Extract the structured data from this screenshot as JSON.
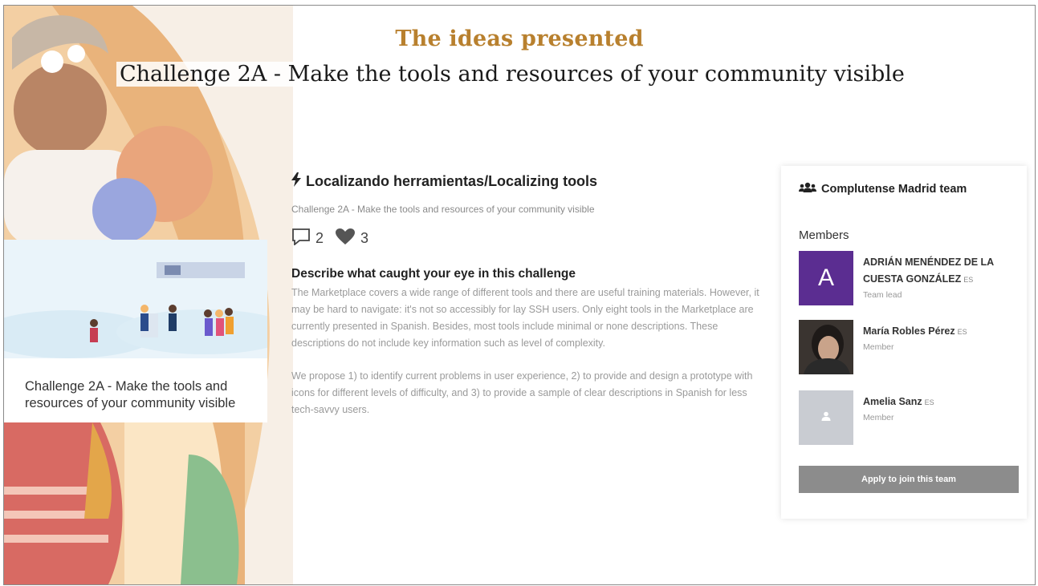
{
  "slide": {
    "title": "The ideas presented",
    "subtitle": "Challenge 2A - Make the tools and resources of your community visible"
  },
  "challenge_card": {
    "caption": "Challenge 2A - Make the tools and resources of your community visible"
  },
  "idea": {
    "title": "Localizando herramientas/Localizing tools",
    "challenge": "Challenge 2A - Make the tools and resources of your community visible",
    "comments": "2",
    "likes": "3",
    "section_heading": "Describe what caught your eye in this challenge",
    "paragraphs": [
      "The Marketplace covers a wide range of different tools and there are useful training materials. However, it may be hard to navigate: it's not so accessibly for lay SSH users. Only eight tools in the Marketplace are currently presented in Spanish. Besides, most tools include minimal or none descriptions. These descriptions do not include key information such as level of complexity.",
      "We propose 1) to identify current problems in user experience, 2) to provide and design a prototype with icons for different levels of difficulty, and 3) to provide a sample of clear descriptions in Spanish for less tech-savvy users."
    ]
  },
  "team": {
    "name": "Complutense Madrid team",
    "members_label": "Members",
    "members": [
      {
        "initial": "A",
        "name": "ADRIÁN MENÉNDEZ DE LA CUESTA GONZÁLEZ",
        "flag": "ES",
        "role": "Team lead",
        "color": "#5b2d91"
      },
      {
        "name": "María Robles Pérez",
        "flag": "ES",
        "role": "Member"
      },
      {
        "name": "Amelia Sanz",
        "flag": "ES",
        "role": "Member",
        "color": "#c9ccd2"
      }
    ],
    "apply_label": "Apply to join this team"
  }
}
